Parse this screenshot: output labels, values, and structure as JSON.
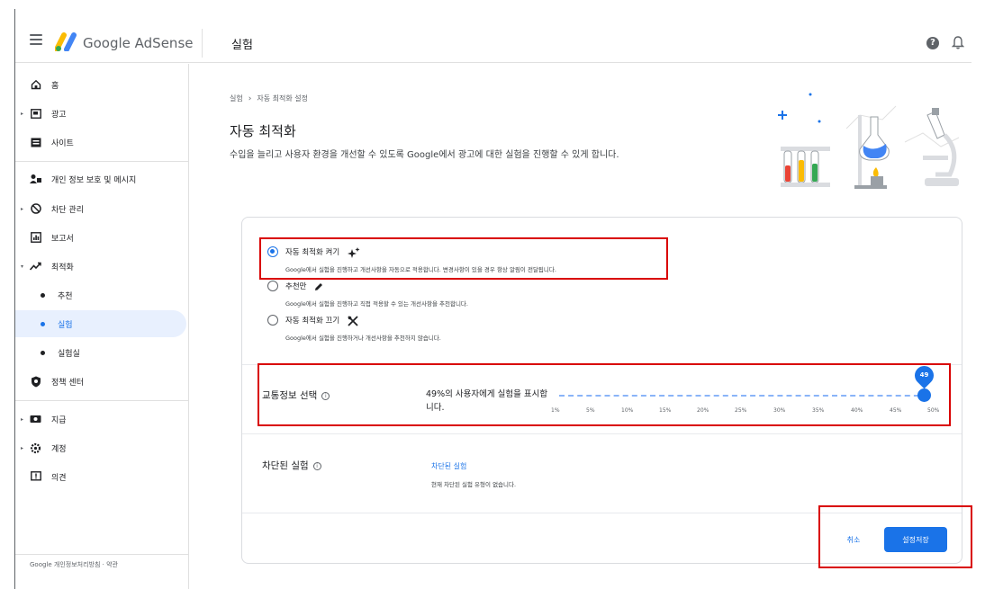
{
  "topbar": {
    "brand": "Google AdSense",
    "section_title": "실험"
  },
  "sidebar": {
    "items": [
      {
        "label": "홈",
        "icon": "home-icon"
      },
      {
        "label": "광고",
        "icon": "ads-icon"
      },
      {
        "label": "사이트",
        "icon": "sites-icon"
      },
      {
        "label": "개인 정보 보호 및 메시지",
        "icon": "privacy-messaging-icon"
      },
      {
        "label": "차단 관리",
        "icon": "block-icon"
      },
      {
        "label": "보고서",
        "icon": "reports-icon"
      },
      {
        "label": "최적화",
        "icon": "optimization-icon"
      },
      {
        "label": "추천",
        "icon": "dot"
      },
      {
        "label": "실험",
        "icon": "dot"
      },
      {
        "label": "실험실",
        "icon": "dot"
      },
      {
        "label": "정책 센터",
        "icon": "policy-shield-icon"
      },
      {
        "label": "지급",
        "icon": "payments-icon"
      },
      {
        "label": "계정",
        "icon": "settings-gear-icon"
      },
      {
        "label": "의견",
        "icon": "feedback-icon"
      }
    ],
    "footer": "Google 개인정보처리방침 · 약관"
  },
  "breadcrumb": {
    "parent": "실험",
    "current": "자동 최적화 설정"
  },
  "page": {
    "title": "자동 최적화",
    "description": "수입을 늘리고 사용자 환경을 개선할 수 있도록 Google에서 광고에 대한 실험을 진행할 수 있게 합니다."
  },
  "options": [
    {
      "label": "자동 최적화 켜기",
      "icon": "sparkle-icon",
      "desc": "Google에서 실험을 진행하고 개선사항을 자동으로 적용합니다. 변경사항이 있을 경우 항상 알림이 전달됩니다.",
      "selected": true
    },
    {
      "label": "추천만",
      "icon": "pencil-icon",
      "desc": "Google에서 실험을 진행하고 직접 적용할 수 있는 개선사항을 추천합니다.",
      "selected": false
    },
    {
      "label": "자동 최적화 끄기",
      "icon": "tools-off-icon",
      "desc": "Google에서 실험을 진행하거나 개선사항을 추천하지 않습니다.",
      "selected": false
    }
  ],
  "traffic": {
    "label": "교통정보 선택",
    "text": "49%의 사용자에게 실험을 표시합니다.",
    "value_percent": 49,
    "value_label": "49",
    "ticks": [
      "1%",
      "5%",
      "10%",
      "15%",
      "20%",
      "25%",
      "30%",
      "35%",
      "40%",
      "45%",
      "50%"
    ]
  },
  "blocked": {
    "label": "차단된 실험",
    "link": "차단된 실험",
    "desc": "현재 차단된 실험 유형이 없습니다."
  },
  "actions": {
    "cancel": "취소",
    "save": "설정저장"
  },
  "colors": {
    "accent": "#1a73e8",
    "highlight": "#d90000"
  }
}
